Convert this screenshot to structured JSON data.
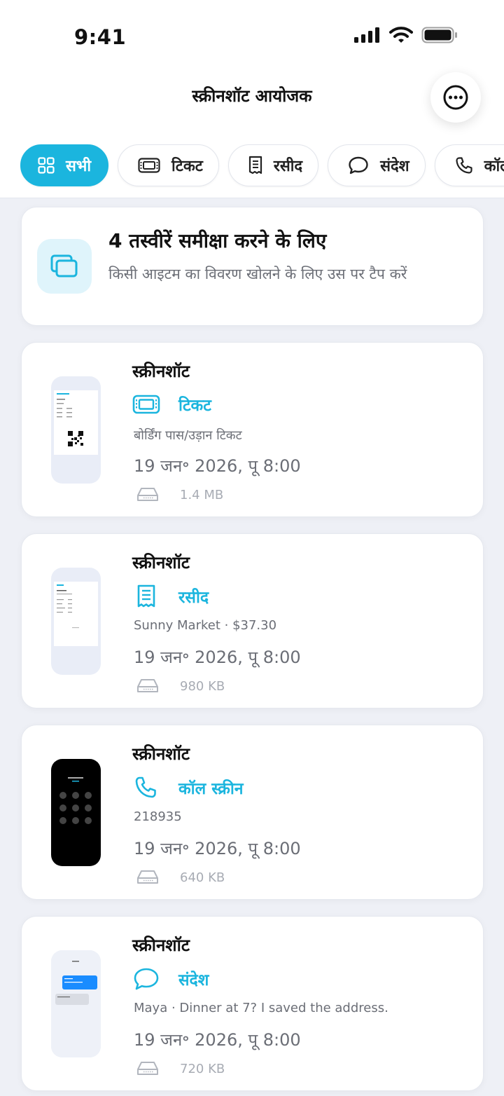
{
  "status_bar": {
    "time": "9:41"
  },
  "header": {
    "title": "स्क्रीनशॉट आयोजक",
    "more_icon": "ellipsis-circle-icon"
  },
  "filters": [
    {
      "label": "सभी",
      "icon": "grid-icon",
      "active": true
    },
    {
      "label": "टिकट",
      "icon": "ticket-icon",
      "active": false
    },
    {
      "label": "रसीद",
      "icon": "receipt-icon",
      "active": false
    },
    {
      "label": "संदेश",
      "icon": "message-icon",
      "active": false
    },
    {
      "label": "कॉल",
      "icon": "phone-icon",
      "active": false
    }
  ],
  "summary": {
    "title": "4 तस्वीरें समीक्षा करने के लिए",
    "subtitle": "किसी आइटम का विवरण खोलने के लिए उस पर टैप करें",
    "icon": "photos-stack-icon"
  },
  "items": [
    {
      "title": "स्क्रीनशॉट",
      "category": "टिकट",
      "category_icon": "ticket-icon",
      "description": "बोर्डिंग पास/उड़ान टिकट",
      "date": "19 जन॰ 2026, पू 8:00",
      "size": "1.4 MB",
      "thumb": "ticket"
    },
    {
      "title": "स्क्रीनशॉट",
      "category": "रसीद",
      "category_icon": "receipt-icon",
      "description": "Sunny Market · $37.30",
      "date": "19 जन॰ 2026, पू 8:00",
      "size": "980 KB",
      "thumb": "receipt"
    },
    {
      "title": "स्क्रीनशॉट",
      "category": "कॉल स्क्रीन",
      "category_icon": "phone-icon",
      "description": "218935",
      "date": "19 जन॰ 2026, पू 8:00",
      "size": "640 KB",
      "thumb": "call"
    },
    {
      "title": "स्क्रीनशॉट",
      "category": "संदेश",
      "category_icon": "message-icon",
      "description": "Maya · Dinner at 7? I saved the address.",
      "date": "19 जन॰ 2026, पू 8:00",
      "size": "720 KB",
      "thumb": "message"
    }
  ],
  "colors": {
    "accent": "#1bb5de",
    "background": "#eef0f6",
    "card": "#ffffff",
    "muted_text": "#6b6e76"
  }
}
